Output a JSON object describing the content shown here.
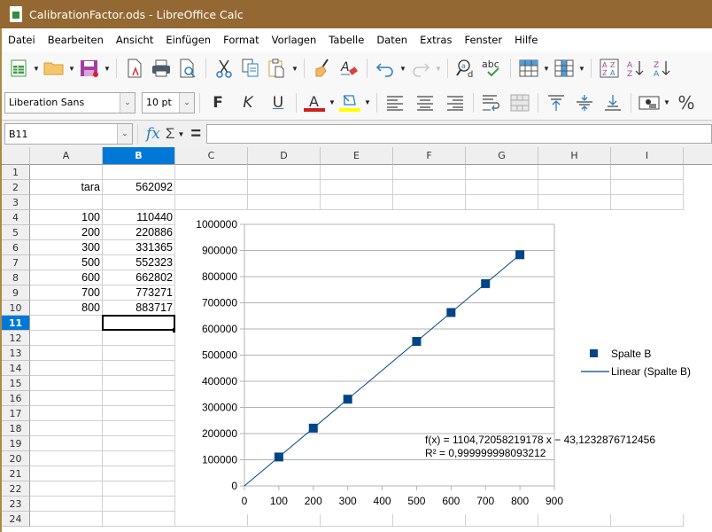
{
  "window": {
    "title": "CalibrationFactor.ods - LibreOffice Calc"
  },
  "menubar": {
    "items": [
      "Datei",
      "Bearbeiten",
      "Ansicht",
      "Einfügen",
      "Format",
      "Vorlagen",
      "Tabelle",
      "Daten",
      "Extras",
      "Fenster",
      "Hilfe"
    ]
  },
  "toolbar_standard": {
    "icons": [
      "new-spreadsheet-icon",
      "open-folder-icon",
      "save-icon",
      "export-pdf-icon",
      "print-icon",
      "print-preview-icon",
      "cut-icon",
      "copy-icon",
      "paste-icon",
      "clone-formatting-icon",
      "clear-formatting-icon",
      "undo-icon",
      "redo-icon",
      "find-replace-icon",
      "spelling-icon",
      "row-icon",
      "column-icon",
      "sort-icon",
      "sort-ascending-icon",
      "sort-descending-icon"
    ]
  },
  "toolbar_formatting": {
    "font_name": "Liberation Sans",
    "font_size": "10 pt",
    "bold_label": "F",
    "italic_label": "K",
    "underline_label": "U",
    "font_color": "#c9211e",
    "highlight_color": "#ffff00",
    "percent_label": "%"
  },
  "formula_bar": {
    "name_box": "B11",
    "fx_label": "fx",
    "sum_label": "Σ",
    "equals_label": "=",
    "content": ""
  },
  "sheet": {
    "columns": [
      "A",
      "B",
      "C",
      "D",
      "E",
      "F",
      "G",
      "H",
      "I"
    ],
    "selected_column": "B",
    "rows": [
      "1",
      "2",
      "3",
      "4",
      "5",
      "6",
      "7",
      "8",
      "9",
      "10",
      "11",
      "12",
      "13",
      "14",
      "15",
      "16",
      "17",
      "18",
      "19",
      "20",
      "21",
      "22",
      "23",
      "24"
    ],
    "selected_row": "11",
    "active_cell": "B11",
    "cells": {
      "A2": "tara",
      "B2": "562092",
      "A4": "100",
      "B4": "110440",
      "A5": "200",
      "B5": "220886",
      "A6": "300",
      "B6": "331365",
      "A7": "500",
      "B7": "552323",
      "A8": "600",
      "B8": "662802",
      "A9": "700",
      "B9": "773271",
      "A10": "800",
      "B10": "883717"
    }
  },
  "chart_data": {
    "type": "scatter",
    "title": "",
    "xlabel": "",
    "ylabel": "",
    "xlim": [
      0,
      900
    ],
    "ylim": [
      0,
      1000000
    ],
    "x_ticks": [
      "0",
      "100",
      "200",
      "300",
      "400",
      "500",
      "600",
      "700",
      "800",
      "900"
    ],
    "y_ticks": [
      "0",
      "100000",
      "200000",
      "300000",
      "400000",
      "500000",
      "600000",
      "700000",
      "800000",
      "900000",
      "1000000"
    ],
    "grid": "horizontal",
    "legend_position": "right",
    "series": [
      {
        "name": "Spalte B",
        "marker": "square",
        "color": "#004586",
        "x": [
          100,
          200,
          300,
          500,
          600,
          700,
          800
        ],
        "y": [
          110440,
          220886,
          331365,
          552323,
          662802,
          773271,
          883717
        ]
      }
    ],
    "trendline": {
      "name": "Linear (Spalte B)",
      "type": "linear",
      "slope": 1104.72058219178,
      "intercept": -43.1232876712456,
      "x_range": [
        0,
        800
      ],
      "color": "#004586",
      "equation_label": "f(x) = 1104,72058219178 x − 43,1232876712456",
      "r2_label": "R² = 0,999999998093212"
    }
  }
}
